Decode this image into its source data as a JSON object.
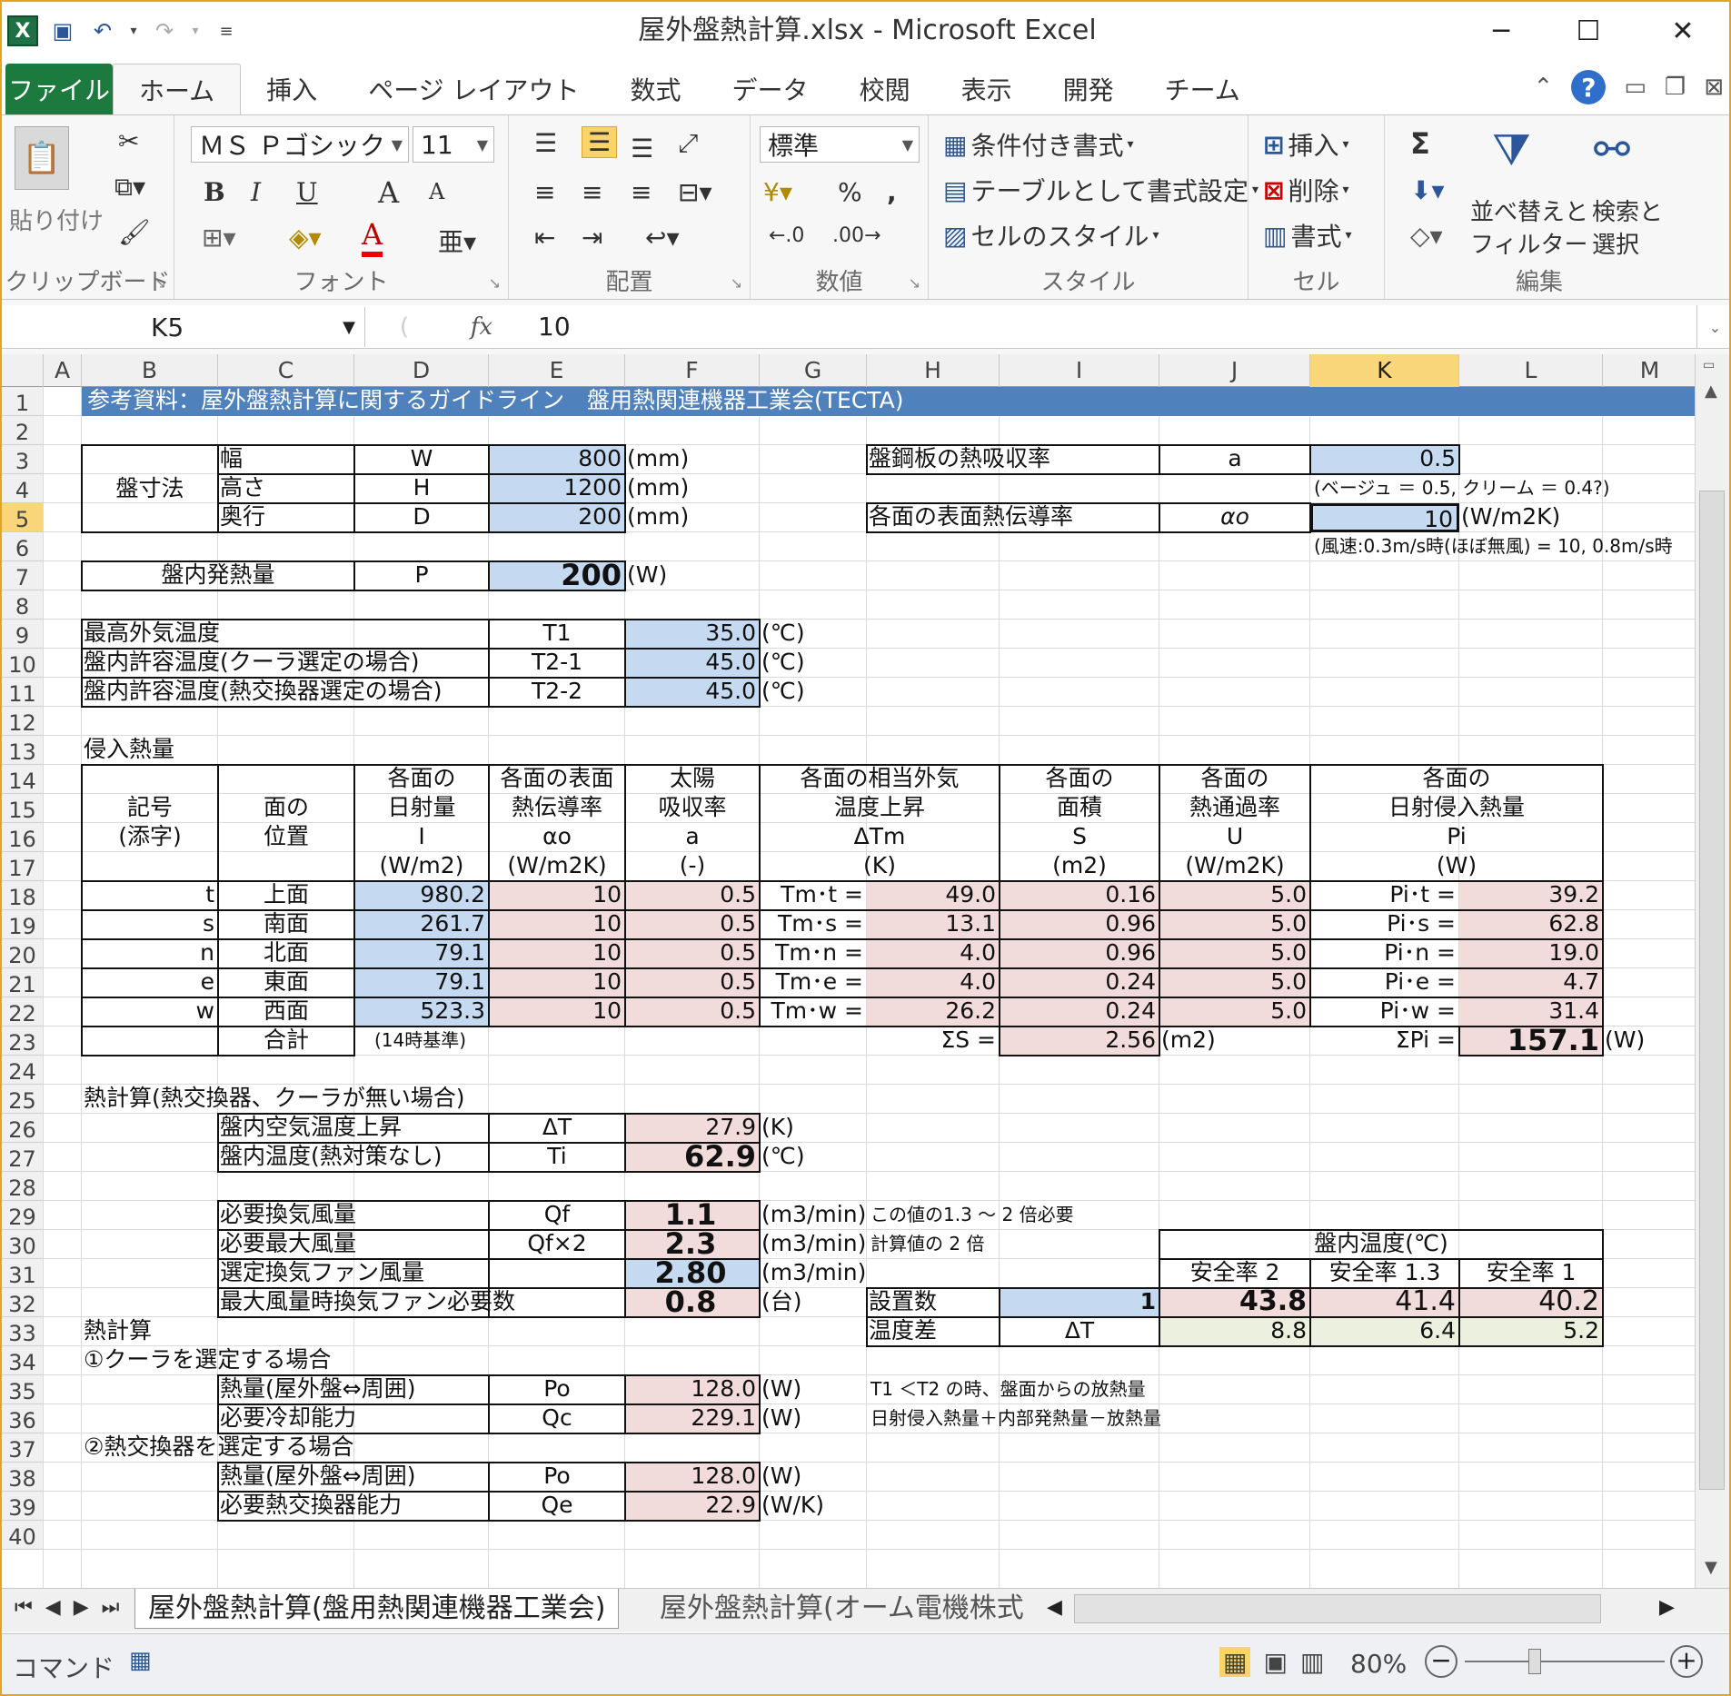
{
  "window": {
    "title": "屋外盤熱計算.xlsx - Microsoft Excel",
    "minimize": "─",
    "maximize": "☐",
    "close": "✕"
  },
  "tabs": {
    "file": "ファイル",
    "items": [
      "ホーム",
      "挿入",
      "ページ レイアウト",
      "数式",
      "データ",
      "校閲",
      "表示",
      "開発",
      "チーム"
    ]
  },
  "ribbon": {
    "clipboard": {
      "paste": "貼り付け",
      "label": "クリップボード"
    },
    "font": {
      "name": "ＭＳ Ｐゴシック",
      "size": "11",
      "bold": "B",
      "italic": "I",
      "underline": "U",
      "grow": "A",
      "shrink": "A",
      "color_letter": "A",
      "label": "フォント"
    },
    "align": {
      "label": "配置"
    },
    "number": {
      "format": "標準",
      "percent": "%",
      "comma": ",",
      "label": "数値"
    },
    "styles": {
      "conditional": "条件付き書式",
      "table": "テーブルとして書式設定",
      "cell": "セルのスタイル",
      "label": "スタイル"
    },
    "cells": {
      "insert": "挿入",
      "delete": "削除",
      "format": "書式",
      "label": "セル"
    },
    "editing": {
      "sum": "Σ",
      "sort_l1": "並べ替えと",
      "sort_l2": "フィルター",
      "find_l1": "検索と",
      "find_l2": "選択",
      "label": "編集"
    }
  },
  "formula": {
    "namebox": "K5",
    "fx": "fx",
    "value": "10"
  },
  "columns": [
    "A",
    "B",
    "C",
    "D",
    "E",
    "F",
    "G",
    "H",
    "I",
    "J",
    "K",
    "L",
    "M"
  ],
  "rows": [
    "1",
    "2",
    "3",
    "4",
    "5",
    "6",
    "7",
    "8",
    "9",
    "10",
    "11",
    "12",
    "13",
    "14",
    "15",
    "16",
    "17",
    "18",
    "19",
    "20",
    "21",
    "22",
    "23",
    "24",
    "25",
    "26",
    "27",
    "28",
    "29",
    "30",
    "31",
    "32",
    "33",
    "34",
    "35",
    "36",
    "37",
    "38",
    "39",
    "40"
  ],
  "sheet": {
    "header": "参考資料：屋外盤熱計算に関するガイドライン　盤用熱関連機器工業会(TECTA)",
    "dim_label": "盤寸法",
    "dims": [
      {
        "name": "幅",
        "sym": "W",
        "val": "800",
        "unit": "(mm)"
      },
      {
        "name": "高さ",
        "sym": "H",
        "val": "1200",
        "unit": "(mm)"
      },
      {
        "name": "奥行",
        "sym": "D",
        "val": "200",
        "unit": "(mm)"
      }
    ],
    "absorb": {
      "name": "盤鋼板の熱吸収率",
      "sym": "a",
      "val": "0.5",
      "note": "(ベージュ ＝ 0.5, クリーム ＝ 0.4?)"
    },
    "surf": {
      "name": "各面の表面熱伝導率",
      "sym": "αo",
      "val": "10",
      "unit": "(W/m2K)",
      "note": "(風速:0.3m/s時(ほぼ無風) = 10, 0.8m/s時"
    },
    "heat": {
      "name": "盤内発熱量",
      "sym": "P",
      "val": "200",
      "unit": "(W)"
    },
    "temps": [
      {
        "name": "最高外気温度",
        "sym": "T1",
        "val": "35.0",
        "unit": "(℃)"
      },
      {
        "name": "盤内許容温度(クーラ選定の場合)",
        "sym": "T2-1",
        "val": "45.0",
        "unit": "(℃)"
      },
      {
        "name": "盤内許容温度(熱交換器選定の場合)",
        "sym": "T2-2",
        "val": "45.0",
        "unit": "(℃)"
      }
    ],
    "intrusion_title": "侵入熱量",
    "th": {
      "b": [
        "記号",
        "(添字)"
      ],
      "c": [
        "面の",
        "位置"
      ],
      "d": [
        "各面の",
        "日射量",
        "I",
        "(W/m2)"
      ],
      "e": [
        "各面の表面",
        "熱伝導率",
        "αo",
        "(W/m2K)"
      ],
      "f": [
        "太陽",
        "吸収率",
        "a",
        "(-)"
      ],
      "gh": [
        "各面の相当外気",
        "温度上昇",
        "ΔTm",
        "(K)"
      ],
      "i": [
        "各面の",
        "面積",
        "S",
        "(m2)"
      ],
      "j": [
        "各面の",
        "熱通過率",
        "U",
        "(W/m2K)"
      ],
      "kl": [
        "各面の",
        "日射侵入熱量",
        "Pi",
        "(W)"
      ]
    },
    "table": [
      {
        "s": "t",
        "pos": "上面",
        "I": "980.2",
        "ao": "10",
        "a": "0.5",
        "tml": "Tm･t =",
        "tm": "49.0",
        "S": "0.16",
        "U": "5.0",
        "pil": "Pi･t =",
        "pi": "39.2"
      },
      {
        "s": "s",
        "pos": "南面",
        "I": "261.7",
        "ao": "10",
        "a": "0.5",
        "tml": "Tm･s =",
        "tm": "13.1",
        "S": "0.96",
        "U": "5.0",
        "pil": "Pi･s =",
        "pi": "62.8"
      },
      {
        "s": "n",
        "pos": "北面",
        "I": "79.1",
        "ao": "10",
        "a": "0.5",
        "tml": "Tm･n =",
        "tm": "4.0",
        "S": "0.96",
        "U": "5.0",
        "pil": "Pi･n =",
        "pi": "19.0"
      },
      {
        "s": "e",
        "pos": "東面",
        "I": "79.1",
        "ao": "10",
        "a": "0.5",
        "tml": "Tm･e =",
        "tm": "4.0",
        "S": "0.24",
        "U": "5.0",
        "pil": "Pi･e =",
        "pi": "4.7"
      },
      {
        "s": "w",
        "pos": "西面",
        "I": "523.3",
        "ao": "10",
        "a": "0.5",
        "tml": "Tm･w =",
        "tm": "26.2",
        "S": "0.24",
        "U": "5.0",
        "pil": "Pi･w =",
        "pi": "31.4"
      }
    ],
    "total": {
      "label": "合計",
      "note": "(14時基準)",
      "sl": "ΣS =",
      "s": "2.56",
      "su": "(m2)",
      "pl": "ΣPi =",
      "p": "157.1",
      "pu": "(W)"
    },
    "calc1_title": "熱計算(熱交換器、クーラが無い場合)",
    "rise": {
      "name": "盤内空気温度上昇",
      "sym": "ΔT",
      "val": "27.9",
      "unit": "(K)"
    },
    "inner": {
      "name": "盤内温度(熱対策なし)",
      "sym": "Ti",
      "val": "62.9",
      "unit": "(℃)"
    },
    "vent": [
      {
        "name": "必要換気風量",
        "sym": "Qf",
        "val": "1.1",
        "unit": "(m3/min)",
        "note": "この値の1.3 ～ 2 倍必要"
      },
      {
        "name": "必要最大風量",
        "sym": "Qf×2",
        "val": "2.3",
        "unit": "(m3/min)",
        "note": "計算値の 2 倍"
      },
      {
        "name": "選定換気ファン風量",
        "sym": "",
        "val": "2.80",
        "unit": "(m3/min)",
        "note": ""
      },
      {
        "name": "最大風量時換気ファン必要数",
        "sym": "",
        "val": "0.8",
        "unit": "(台)",
        "note": ""
      }
    ],
    "safety": {
      "title": "盤内温度(℃)",
      "h": [
        "安全率 2",
        "安全率 1.3",
        "安全率 1"
      ],
      "count_label": "設置数",
      "count": "1",
      "temps": [
        "43.8",
        "41.4",
        "40.2"
      ],
      "diff_label": "温度差",
      "diff_sym": "ΔT",
      "diffs": [
        "8.8",
        "6.4",
        "5.2"
      ]
    },
    "calc2_title": "熱計算",
    "cooler_title": "①クーラを選定する場合",
    "cooler": [
      {
        "name": "熱量(屋外盤⇔周囲)",
        "sym": "Po",
        "val": "128.0",
        "unit": "(W)",
        "note": "T1 ＜T2 の時、盤面からの放熱量"
      },
      {
        "name": "必要冷却能力",
        "sym": "Qc",
        "val": "229.1",
        "unit": "(W)",
        "note": "日射侵入熱量＋内部発熱量－放熱量"
      }
    ],
    "hx_title": "②熱交換器を選定する場合",
    "hx": [
      {
        "name": "熱量(屋外盤⇔周囲)",
        "sym": "Po",
        "val": "128.0",
        "unit": "(W)"
      },
      {
        "name": "必要熱交換器能力",
        "sym": "Qe",
        "val": "22.9",
        "unit": "(W/K)"
      }
    ]
  },
  "sheet_tabs": [
    "屋外盤熱計算(盤用熱関連機器工業会)",
    "屋外盤熱計算(オーム電機株式"
  ],
  "status": {
    "mode": "コマンド",
    "zoom": "80%",
    "minus": "−",
    "plus": "+"
  },
  "colors": {
    "accent_green": "#1d7a3e",
    "header_blue": "#4f81bd",
    "input_blue": "#c5d9f1",
    "calc_pink": "#f2dcdb",
    "diff_green": "#ebf1de",
    "window_border": "#e2a422"
  }
}
